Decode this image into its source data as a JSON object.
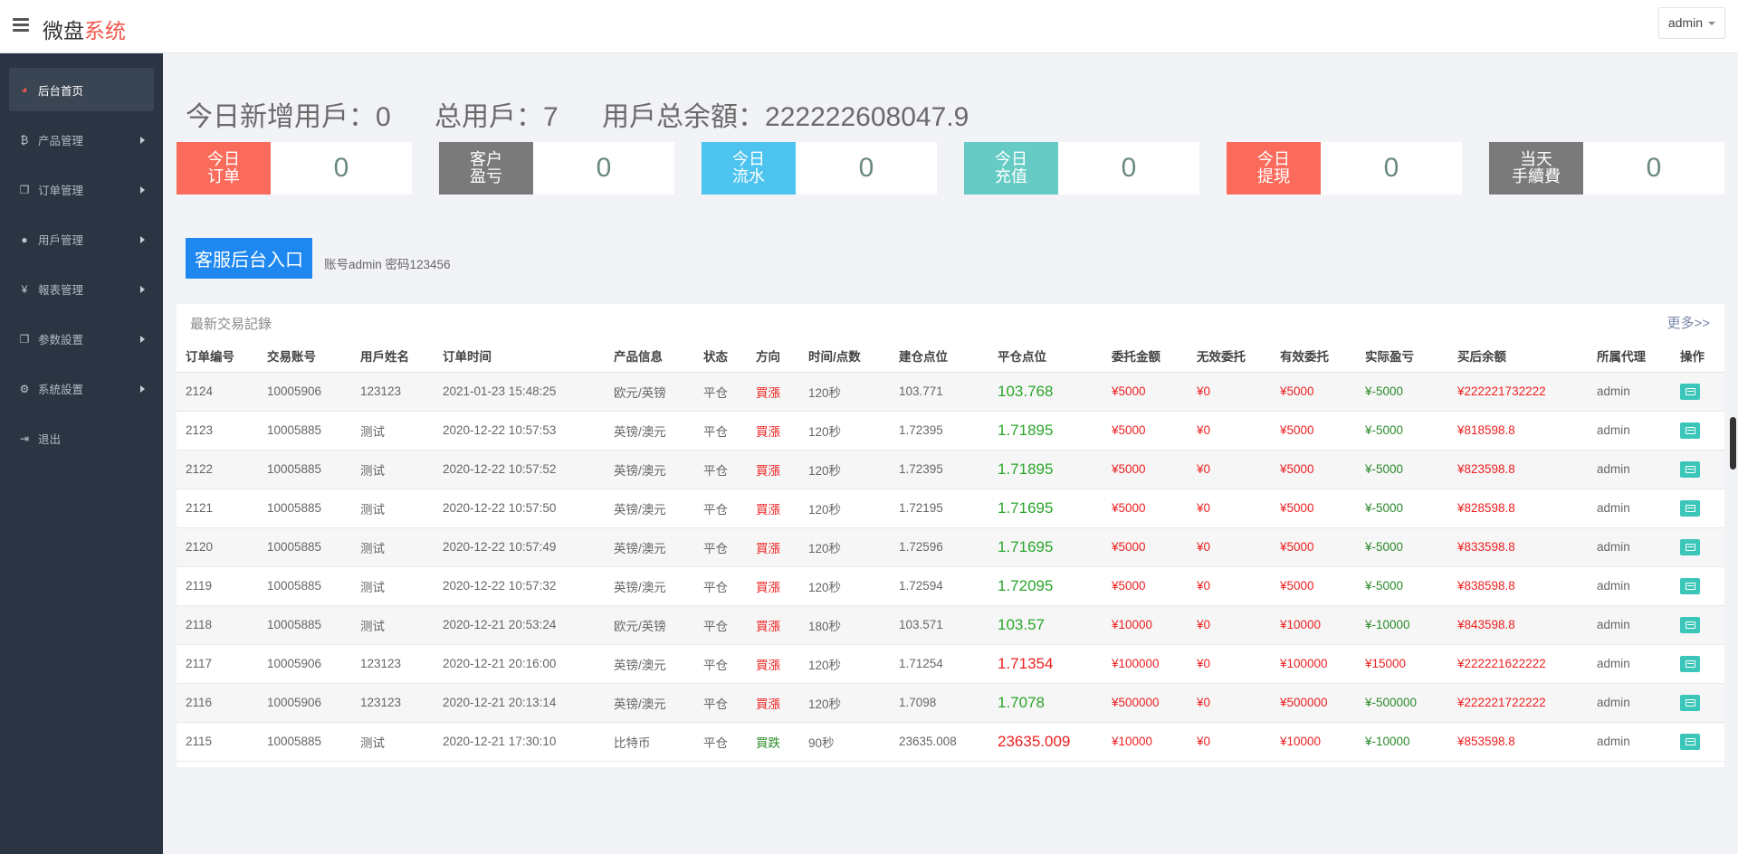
{
  "header": {
    "brand_main": "微盘",
    "brand_accent": "系统",
    "user": "admin"
  },
  "sidebar": {
    "items": [
      {
        "label": "后台首页",
        "icon": "dashboard-icon"
      },
      {
        "label": "产品管理",
        "icon": "bitcoin-icon"
      },
      {
        "label": "订单管理",
        "icon": "copy-icon"
      },
      {
        "label": "用戶管理",
        "icon": "user-icon"
      },
      {
        "label": "報表管理",
        "icon": "yen-icon"
      },
      {
        "label": "参数設置",
        "icon": "copy-icon"
      },
      {
        "label": "系統設置",
        "icon": "gears-icon"
      },
      {
        "label": "退出",
        "icon": "sign-out-icon"
      }
    ]
  },
  "summary": {
    "new_users": "今日新增用戶：0",
    "total_users": "总用戶：7",
    "total_balance": "用戶总余額：222222608047.9"
  },
  "stats": [
    {
      "label": "今日\n订单",
      "value": "0",
      "color": "#fb6b5b"
    },
    {
      "label": "客户\n盈亏",
      "value": "0",
      "color": "#7a7a7a"
    },
    {
      "label": "今日\n流水",
      "value": "0",
      "color": "#4dc3ef"
    },
    {
      "label": "今日\n充值",
      "value": "0",
      "color": "#66cbc4"
    },
    {
      "label": "今日\n提現",
      "value": "0",
      "color": "#fb6b5b"
    },
    {
      "label": "当天\n手續費",
      "value": "0",
      "color": "#7a7a7a"
    }
  ],
  "service": {
    "button": "客服后台入口",
    "note": "账号admin 密码123456"
  },
  "trades": {
    "title": "最新交易記錄",
    "more": "更多>>",
    "columns": [
      "订单编号",
      "交易账号",
      "用戶姓名",
      "订单时间",
      "产品信息",
      "状态",
      "方向",
      "时间/点数",
      "建仓点位",
      "平仓点位",
      "委托金额",
      "无效委托",
      "有效委托",
      "实际盈亏",
      "买后余额",
      "所属代理",
      "操作"
    ],
    "rows": [
      [
        "2124",
        "10005906",
        "123123",
        "2021-01-23 15:48:25",
        "欧元/英镑",
        "平仓",
        "買漲",
        "120秒",
        "103.771",
        "103.768",
        "¥5000",
        "¥0",
        "¥5000",
        "¥-5000",
        "¥222221732222",
        "admin"
      ],
      [
        "2123",
        "10005885",
        "测试",
        "2020-12-22 10:57:53",
        "英镑/澳元",
        "平仓",
        "買漲",
        "120秒",
        "1.72395",
        "1.71895",
        "¥5000",
        "¥0",
        "¥5000",
        "¥-5000",
        "¥818598.8",
        "admin"
      ],
      [
        "2122",
        "10005885",
        "测试",
        "2020-12-22 10:57:52",
        "英镑/澳元",
        "平仓",
        "買漲",
        "120秒",
        "1.72395",
        "1.71895",
        "¥5000",
        "¥0",
        "¥5000",
        "¥-5000",
        "¥823598.8",
        "admin"
      ],
      [
        "2121",
        "10005885",
        "测试",
        "2020-12-22 10:57:50",
        "英镑/澳元",
        "平仓",
        "買漲",
        "120秒",
        "1.72195",
        "1.71695",
        "¥5000",
        "¥0",
        "¥5000",
        "¥-5000",
        "¥828598.8",
        "admin"
      ],
      [
        "2120",
        "10005885",
        "测试",
        "2020-12-22 10:57:49",
        "英镑/澳元",
        "平仓",
        "買漲",
        "120秒",
        "1.72596",
        "1.71695",
        "¥5000",
        "¥0",
        "¥5000",
        "¥-5000",
        "¥833598.8",
        "admin"
      ],
      [
        "2119",
        "10005885",
        "测试",
        "2020-12-22 10:57:32",
        "英镑/澳元",
        "平仓",
        "買漲",
        "120秒",
        "1.72594",
        "1.72095",
        "¥5000",
        "¥0",
        "¥5000",
        "¥-5000",
        "¥838598.8",
        "admin"
      ],
      [
        "2118",
        "10005885",
        "测试",
        "2020-12-21 20:53:24",
        "欧元/英镑",
        "平仓",
        "買漲",
        "180秒",
        "103.571",
        "103.57",
        "¥10000",
        "¥0",
        "¥10000",
        "¥-10000",
        "¥843598.8",
        "admin"
      ],
      [
        "2117",
        "10005906",
        "123123",
        "2020-12-21 20:16:00",
        "英镑/澳元",
        "平仓",
        "買漲",
        "120秒",
        "1.71254",
        "1.71354",
        "¥100000",
        "¥0",
        "¥100000",
        "¥15000",
        "¥222221622222",
        "admin"
      ],
      [
        "2116",
        "10005906",
        "123123",
        "2020-12-21 20:13:14",
        "英镑/澳元",
        "平仓",
        "買漲",
        "120秒",
        "1.7098",
        "1.7078",
        "¥500000",
        "¥0",
        "¥500000",
        "¥-500000",
        "¥222221722222",
        "admin"
      ],
      [
        "2115",
        "10005885",
        "测试",
        "2020-12-21 17:30:10",
        "比特币",
        "平仓",
        "買跌",
        "90秒",
        "23635.008",
        "23635.009",
        "¥10000",
        "¥0",
        "¥10000",
        "¥-10000",
        "¥853598.8",
        "admin"
      ]
    ],
    "close_color": [
      "green",
      "green",
      "green",
      "green",
      "green",
      "green",
      "green",
      "red",
      "green",
      "red"
    ],
    "direction_color": [
      "red",
      "red",
      "red",
      "red",
      "red",
      "red",
      "red",
      "red",
      "red",
      "green"
    ],
    "pnl_color": [
      "green",
      "green",
      "green",
      "green",
      "green",
      "green",
      "green",
      "red",
      "green",
      "green"
    ]
  }
}
